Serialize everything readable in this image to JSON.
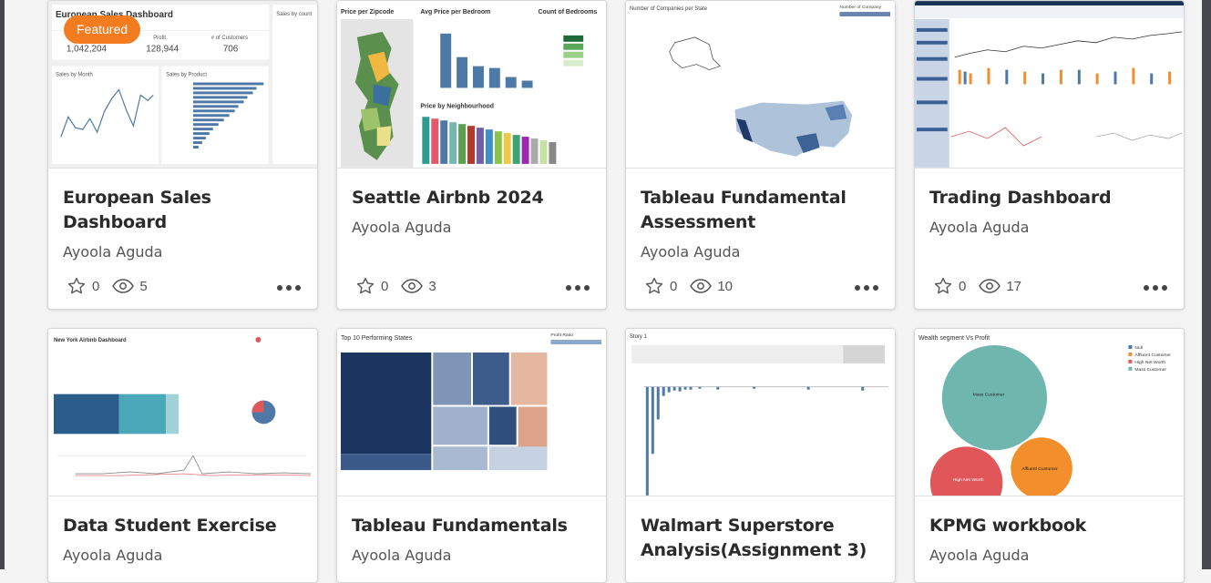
{
  "cards": [
    {
      "title": "European Sales Dashboard",
      "author": "Ayoola Aguda",
      "favorites": "0",
      "views": "5",
      "featured": "Featured"
    },
    {
      "title": "Seattle Airbnb 2024",
      "author": "Ayoola Aguda",
      "favorites": "0",
      "views": "3"
    },
    {
      "title": "Tableau Fundamental Assessment",
      "author": "Ayoola Aguda",
      "favorites": "0",
      "views": "10"
    },
    {
      "title": "Trading Dashboard",
      "author": "Ayoola Aguda",
      "favorites": "0",
      "views": "17"
    },
    {
      "title": "Data Student Exercise",
      "author": "Ayoola Aguda"
    },
    {
      "title": "Tableau Fundamentals",
      "author": "Ayoola Aguda"
    },
    {
      "title": "Walmart Superstore Analysis(Assignment 3)",
      "author": ""
    },
    {
      "title": "KPMG workbook",
      "author": "Ayoola Aguda"
    }
  ],
  "thumbs": {
    "euro": {
      "title": "European Sales Dashboard",
      "m1": "Profit",
      "m2": "# of Customers",
      "v0": "1,042,204",
      "v1": "128,944",
      "v2": "706",
      "month": "Sales by Month",
      "product": "Sales by Product",
      "country": "Sales by count"
    },
    "seattle": {
      "zip": "Price per Zipcode",
      "bed": "Avg Price per Bedroom",
      "count": "Count of Bedrooms",
      "neigh": "Price by Neighbourhood"
    },
    "tfa": {
      "title": "Number of Companies per State",
      "legend": "Number of Company"
    },
    "nyc": {
      "title": "New York Airbnb Dashboard"
    },
    "top10": {
      "title": "Top 10 Performing States",
      "ratio": "Profit Ratio"
    },
    "walmart": {
      "title": "Story 1"
    },
    "kpmg": {
      "title": "Wealth segment Vs Profit",
      "mass": "Mass Customer",
      "high": "High Net Worth",
      "aff": "Affluent Customer",
      "leg1": "Null",
      "leg2": "Affluent Customer",
      "leg3": "High Net Worth",
      "leg4": "Mass Customer"
    }
  },
  "colors": {
    "accent": "#f47c20",
    "tableau_blue": "#4e79a7"
  }
}
